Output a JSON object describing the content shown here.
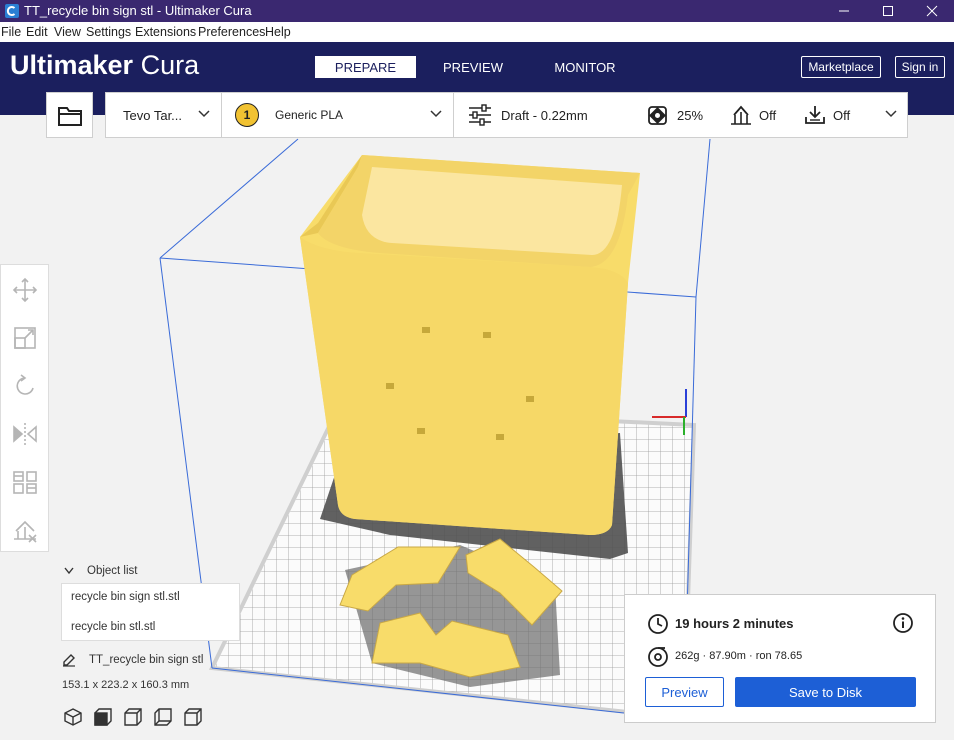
{
  "window": {
    "title": "TT_recycle bin sign stl - Ultimaker Cura"
  },
  "menu": {
    "items": [
      {
        "label": "File"
      },
      {
        "label": "Edit"
      },
      {
        "label": "View"
      },
      {
        "label": "Settings"
      },
      {
        "label": "Extensions"
      },
      {
        "label": "Preferences"
      },
      {
        "label": "Help"
      }
    ]
  },
  "header": {
    "logo_bold": "Ultimaker",
    "logo_light": "Cura",
    "stages": [
      {
        "label": "PREPARE"
      },
      {
        "label": "PREVIEW"
      },
      {
        "label": "MONITOR"
      }
    ],
    "marketplace_label": "Marketplace",
    "signin_label": "Sign in"
  },
  "toolbar": {
    "printer": "Tevo Tar...",
    "extruder_number": "1",
    "material": "Generic PLA",
    "profile": "Draft - 0.22mm",
    "infill": "25%",
    "support": "Off",
    "adhesion": "Off"
  },
  "objects": {
    "header": "Object list",
    "items": [
      {
        "label": "recycle bin sign stl.stl"
      },
      {
        "label": "recycle bin stl.stl"
      }
    ],
    "project_name": "TT_recycle bin sign stl",
    "dimensions": "153.1 x 223.2 x 160.3 mm"
  },
  "print": {
    "time": "19 hours 2 minutes",
    "material_info": "262g · 87.90m · ron 78.65",
    "preview_label": "Preview",
    "save_label": "Save to Disk"
  },
  "colors": {
    "header_bg": "#1b1f5e",
    "titlebar_bg": "#3a2870",
    "accent_blue": "#1d5fd6",
    "model_yellow": "#f8dc6a"
  }
}
